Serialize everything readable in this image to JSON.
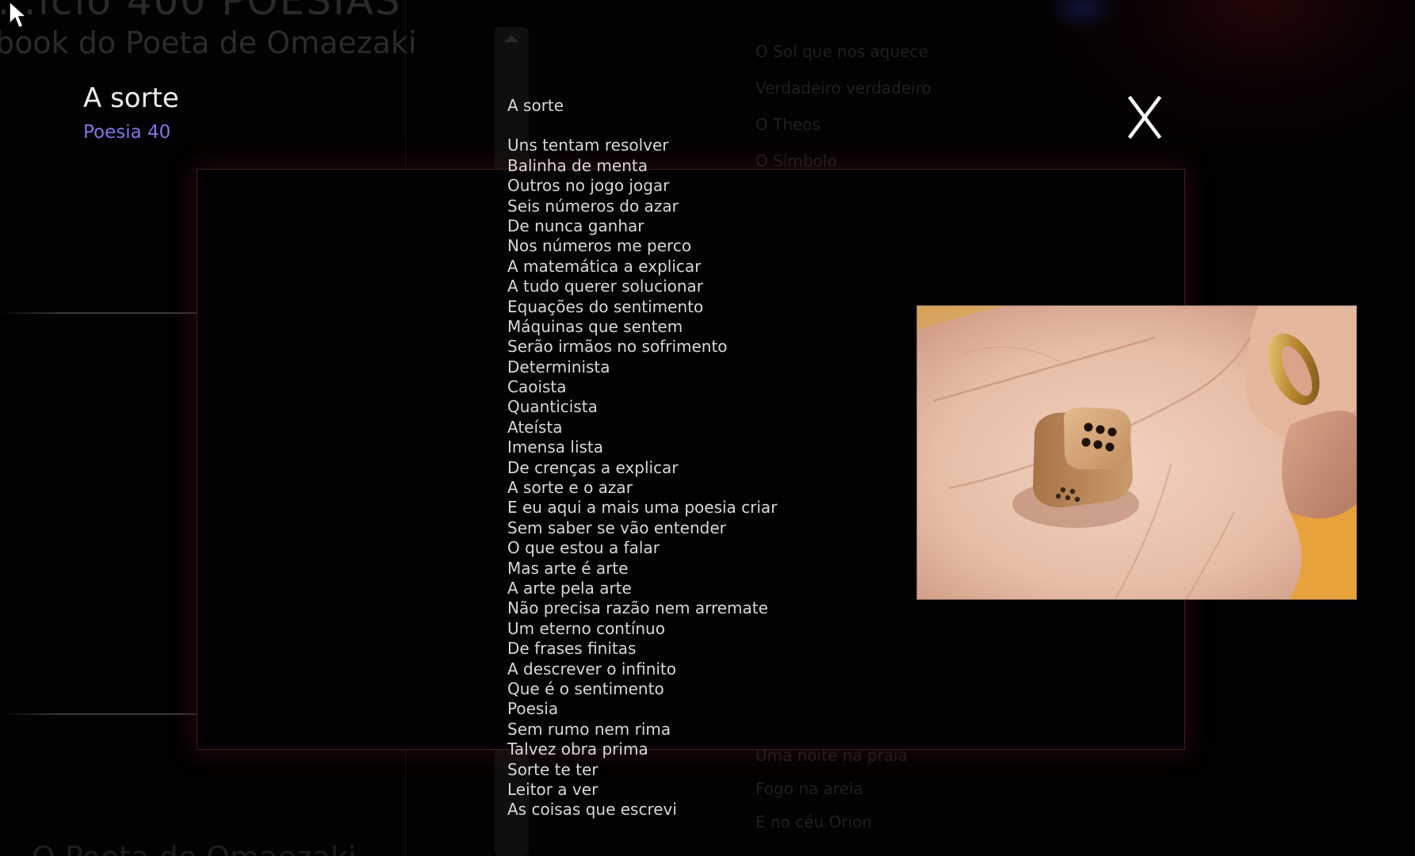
{
  "background": {
    "site_title": "…ício 400 POESIAS",
    "site_subtitle": "book do Poeta de Omaezaki",
    "poem_list_top": [
      "O Sol que nos aquece",
      "Verdadeiro  verdadeiro",
      "O Theos",
      "O Símbolo"
    ],
    "poem_list_bottom": [
      "Uma noite na praia",
      "Fogo na areia",
      "E no céu Orion"
    ],
    "bottom_heading": "O Poeta de Omaezaki"
  },
  "modal": {
    "title": "A sorte",
    "subtitle": "Poesia 40",
    "close_label": "X",
    "photo_icon": "hand-holding-die-photo",
    "colors": {
      "subtitle": "#7d78e6",
      "poem_text": "#d8d8d8",
      "panel_glow": "#5a1414"
    }
  },
  "poem": {
    "heading": "A sorte",
    "lines": [
      "Uns tentam resolver",
      "Balinha de menta",
      "Outros no jogo jogar",
      "Seis números do azar",
      "De nunca ganhar",
      "Nos números me perco",
      "A matemática a explicar",
      "A tudo querer solucionar",
      "Equações do sentimento",
      "Máquinas que sentem",
      "Serão irmãos no sofrimento",
      "Determinista",
      "Caoista",
      "Quanticista",
      "Ateísta",
      "Imensa lista",
      "De crenças a explicar",
      "A sorte e o azar",
      "E eu aqui a mais uma poesia criar",
      "Sem saber se vão entender",
      "O que estou a falar",
      "Mas arte é arte",
      "A arte pela arte",
      "Não precisa razão nem arremate",
      "Um eterno contínuo",
      "De frases finitas",
      "A descrever o infinito",
      "Que é o sentimento",
      "Poesia",
      "Sem rumo nem rima",
      "Talvez obra prima",
      "Sorte te ter",
      "Leitor a ver",
      "As coisas que escrevi"
    ]
  }
}
